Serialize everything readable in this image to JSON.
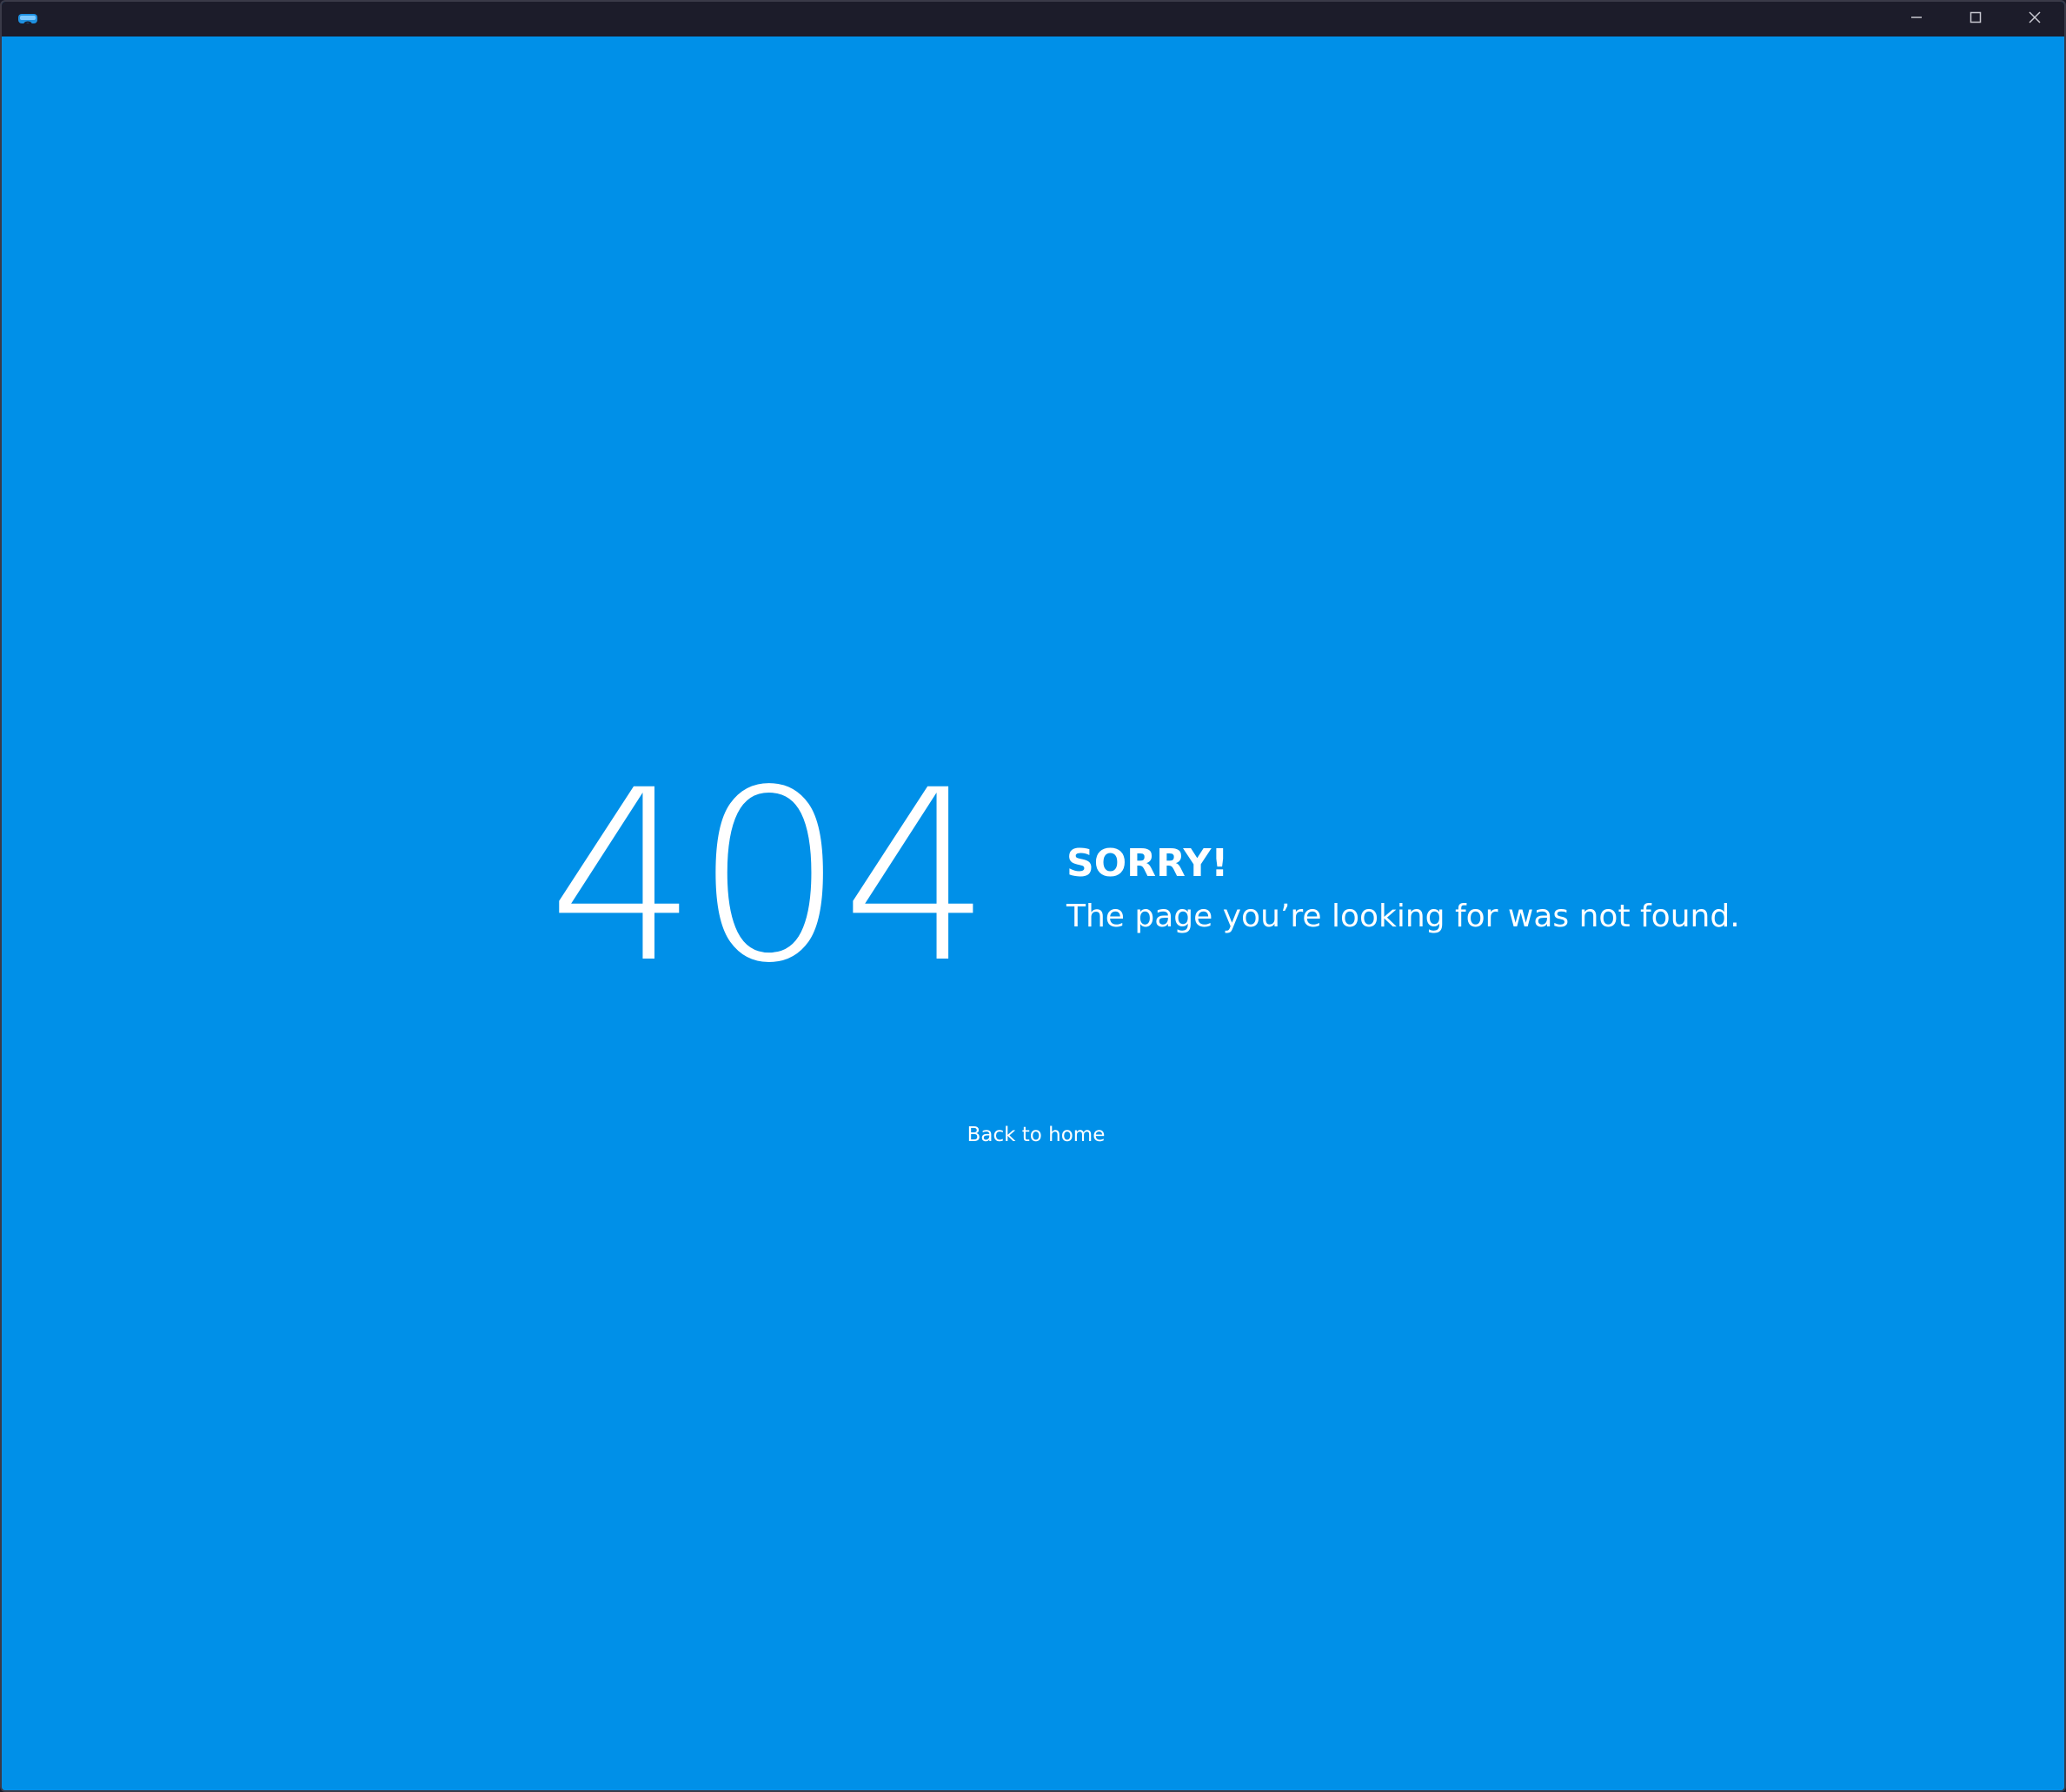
{
  "window": {
    "app_icon": "vr-headset-icon",
    "controls": {
      "minimize_icon": "minimize-icon",
      "maximize_icon": "maximize-icon",
      "close_icon": "close-icon"
    }
  },
  "error_page": {
    "code": "404",
    "title": "SORRY!",
    "message": "The page you’re looking for was not found.",
    "home_link_label": "Back to home"
  },
  "colors": {
    "background": "#0090e8",
    "titlebar": "#1c1c2a",
    "text": "#ffffff"
  }
}
